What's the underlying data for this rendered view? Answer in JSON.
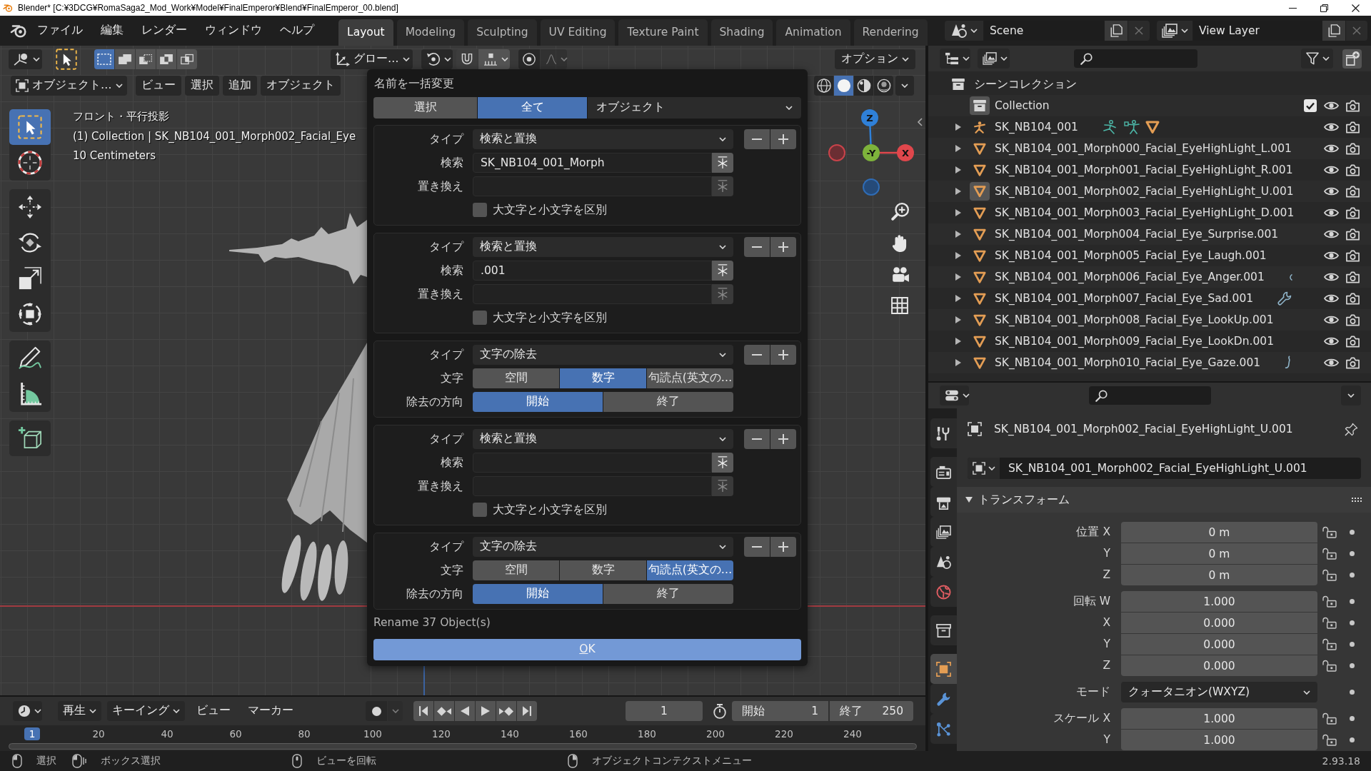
{
  "window": {
    "title": "Blender* [C:¥3DCG¥RomaSaga2_Mod_Work¥Model¥FinalEmperor¥Blend¥FinalEmperor_00.blend]"
  },
  "top_bar": {
    "menus": [
      "ファイル",
      "編集",
      "レンダー",
      "ウィンドウ",
      "ヘルプ"
    ],
    "workspaces": [
      {
        "label": "Layout",
        "selected": true
      },
      {
        "label": "Modeling",
        "selected": false
      },
      {
        "label": "Sculpting",
        "selected": false
      },
      {
        "label": "UV Editing",
        "selected": false
      },
      {
        "label": "Texture Paint",
        "selected": false
      },
      {
        "label": "Shading",
        "selected": false
      },
      {
        "label": "Animation",
        "selected": false
      },
      {
        "label": "Rendering",
        "selected": false
      }
    ],
    "scene": "Scene",
    "view_layer": "View Layer"
  },
  "viewport": {
    "select_modes": [
      {
        "kind": "set",
        "selected": true
      },
      {
        "kind": "extend",
        "selected": false
      },
      {
        "kind": "subtract",
        "selected": false
      },
      {
        "kind": "difference",
        "selected": false
      },
      {
        "kind": "intersect",
        "selected": false
      }
    ],
    "orientation": "グロー…",
    "options": "オプション",
    "mode": "オブジェクト…",
    "menus": [
      "ビュー",
      "選択",
      "追加",
      "オブジェクト"
    ],
    "shading_modes": [
      {
        "kind": "wireframe",
        "selected": false
      },
      {
        "kind": "solid",
        "selected": true
      },
      {
        "kind": "material",
        "selected": false
      },
      {
        "kind": "rendered",
        "selected": false
      }
    ],
    "overlay_text": [
      "フロント・平行投影",
      "(1) Collection | SK_NB104_001_Morph002_Facial_Eye",
      "10 Centimeters"
    ],
    "tool_groups": [
      {
        "tools": [
          {
            "kind": "select_box",
            "selected": true
          },
          {
            "kind": "cursor",
            "selected": false
          }
        ]
      },
      {
        "tools": [
          {
            "kind": "move",
            "selected": false
          },
          {
            "kind": "rotate",
            "selected": false
          },
          {
            "kind": "scale",
            "selected": false
          },
          {
            "kind": "transform",
            "selected": false
          }
        ]
      },
      {
        "tools": [
          {
            "kind": "annotate",
            "selected": false
          },
          {
            "kind": "measure",
            "selected": false
          }
        ]
      },
      {
        "tools": [
          {
            "kind": "add_cube",
            "selected": false
          }
        ]
      }
    ],
    "gizmo_axes": [
      {
        "kind": "z",
        "label": "Z"
      },
      {
        "kind": "y",
        "label": "-Y"
      },
      {
        "kind": "x",
        "label": "X"
      }
    ]
  },
  "rename_dialog": {
    "title": "名前を一括変更",
    "scope": [
      {
        "label": "選択",
        "selected": false
      },
      {
        "label": "全て",
        "selected": true
      }
    ],
    "data_type": "オブジェクト",
    "actions": [
      {
        "kind": "replace",
        "type_label": "タイプ",
        "type": "検索と置換",
        "find_label": "検索",
        "find": "SK_NB104_001_Morph",
        "find_regex_disabled": false,
        "replace_label": "置き換え",
        "replace_regex_disabled": true,
        "case_label": "大文字と小文字を区別",
        "case_sensitive": false
      },
      {
        "kind": "replace",
        "type_label": "タイプ",
        "type": "検索と置換",
        "find_label": "検索",
        "find": ".001",
        "find_regex_disabled": false,
        "replace_label": "置き換え",
        "replace_regex_disabled": true,
        "case_label": "大文字と小文字を区別",
        "case_sensitive": false
      },
      {
        "kind": "strip",
        "type_label": "タイプ",
        "type": "文字の除去",
        "chars_label": "文字",
        "chars": [
          {
            "label": "空間",
            "selected": false
          },
          {
            "label": "数字",
            "selected": true
          },
          {
            "label": "句読点(英文の…",
            "selected": false
          }
        ],
        "direction_label": "除去の方向",
        "directions": [
          {
            "label": "開始",
            "selected": true
          },
          {
            "label": "終了",
            "selected": false
          }
        ]
      },
      {
        "kind": "replace",
        "type_label": "タイプ",
        "type": "検索と置換",
        "find_label": "検索",
        "find_regex_disabled": false,
        "replace_label": "置き換え",
        "replace_regex_disabled": true,
        "case_label": "大文字と小文字を区別",
        "case_sensitive": false
      },
      {
        "kind": "strip",
        "type_label": "タイプ",
        "type": "文字の除去",
        "chars_label": "文字",
        "chars": [
          {
            "label": "空間",
            "selected": false
          },
          {
            "label": "数字",
            "selected": false
          },
          {
            "label": "句読点(英文の…",
            "selected": true
          }
        ],
        "direction_label": "除去の方向",
        "directions": [
          {
            "label": "開始",
            "selected": true
          },
          {
            "label": "終了",
            "selected": false
          }
        ]
      }
    ],
    "info": "Rename 37 Object(s)",
    "ok": "OK"
  },
  "outliner": {
    "scene_collection": "シーンコレクション",
    "collection": {
      "label": "Collection",
      "active": true,
      "checked": true
    },
    "objects": [
      {
        "name": "SK_NB104_001",
        "kind": "armature",
        "active": false,
        "expanded": false,
        "extras": [
          {
            "kind": "pose"
          },
          {
            "kind": "armature_data"
          },
          {
            "kind": "mesh"
          }
        ]
      },
      {
        "name": "SK_NB104_001_Morph000_Facial_EyeHighLight_L.001",
        "kind": "mesh",
        "active": false,
        "expanded": false
      },
      {
        "name": "SK_NB104_001_Morph001_Facial_EyeHighLight_R.001",
        "kind": "mesh",
        "active": false,
        "expanded": false
      },
      {
        "name": "SK_NB104_001_Morph002_Facial_EyeHighLight_U.001",
        "kind": "mesh",
        "active": true,
        "expanded": false
      },
      {
        "name": "SK_NB104_001_Morph003_Facial_EyeHighLight_D.001",
        "kind": "mesh",
        "active": false,
        "expanded": false
      },
      {
        "name": "SK_NB104_001_Morph004_Facial_Eye_Surprise.001",
        "kind": "mesh",
        "active": false,
        "expanded": false
      },
      {
        "name": "SK_NB104_001_Morph005_Facial_Eye_Laugh.001",
        "kind": "mesh",
        "active": false,
        "expanded": false
      },
      {
        "name": "SK_NB104_001_Morph006_Facial_Eye_Anger.001",
        "kind": "mesh",
        "active": false,
        "expanded": false,
        "extras": [
          {
            "kind": "arc"
          }
        ]
      },
      {
        "name": "SK_NB104_001_Morph007_Facial_Eye_Sad.001",
        "kind": "mesh",
        "active": false,
        "expanded": false,
        "extras": [
          {
            "kind": "modifier"
          }
        ]
      },
      {
        "name": "SK_NB104_001_Morph008_Facial_Eye_LookUp.001",
        "kind": "mesh",
        "active": false,
        "expanded": false
      },
      {
        "name": "SK_NB104_001_Morph009_Facial_Eye_LookDn.001",
        "kind": "mesh",
        "active": false,
        "expanded": false
      },
      {
        "name": "SK_NB104_001_Morph010_Facial_Eye_Gaze.001",
        "kind": "mesh",
        "active": false,
        "expanded": false,
        "extras": [
          {
            "kind": "hook"
          }
        ]
      }
    ]
  },
  "properties": {
    "tabs": [
      {
        "kind": "tool",
        "selected": false
      },
      {
        "kind": "render",
        "selected": false
      },
      {
        "kind": "output",
        "selected": false
      },
      {
        "kind": "view_layer",
        "selected": false
      },
      {
        "kind": "scene",
        "selected": false
      },
      {
        "kind": "world",
        "selected": false
      },
      {
        "kind": "collection",
        "selected": false
      },
      {
        "kind": "object",
        "selected": true
      },
      {
        "kind": "modifier",
        "selected": false
      },
      {
        "kind": "particles",
        "selected": false
      }
    ],
    "context": "SK_NB104_001_Morph002_Facial_EyeHighLight_U.001",
    "name": "SK_NB104_001_Morph002_Facial_EyeHighLight_U.001",
    "panel": {
      "title": "トランスフォーム",
      "expanded": true
    },
    "groups": [
      {
        "kind": "number",
        "rows": [
          {
            "label": "位置 X",
            "value": "0 m",
            "locked": false
          },
          {
            "label": "Y",
            "value": "0 m",
            "locked": false
          },
          {
            "label": "Z",
            "value": "0 m",
            "locked": false
          }
        ]
      },
      {
        "kind": "number",
        "rows": [
          {
            "label": "回転 W",
            "value": "1.000",
            "locked": false
          },
          {
            "label": "X",
            "value": "0.000",
            "locked": false
          },
          {
            "label": "Y",
            "value": "0.000",
            "locked": false
          },
          {
            "label": "Z",
            "value": "0.000",
            "locked": false
          }
        ]
      },
      {
        "kind": "dropdown",
        "rows": [
          {
            "label": "モード",
            "value": "クォータニオン(WXYZ)"
          }
        ]
      },
      {
        "kind": "number",
        "rows": [
          {
            "label": "スケール X",
            "value": "1.000",
            "locked": false
          },
          {
            "label": "Y",
            "value": "1.000",
            "locked": false
          }
        ]
      }
    ]
  },
  "timeline": {
    "menus": [
      {
        "label": "再生",
        "kind": "dropdown"
      },
      {
        "label": "キーイング",
        "kind": "dropdown"
      },
      {
        "label": "ビュー",
        "kind": "menu"
      },
      {
        "label": "マーカー",
        "kind": "menu"
      }
    ],
    "current_frame": "1",
    "start_label": "開始",
    "start": "1",
    "end_label": "終了",
    "end": "250",
    "ruler": [
      {
        "label": "1",
        "selected": true
      },
      {
        "label": "20",
        "selected": false
      },
      {
        "label": "40",
        "selected": false
      },
      {
        "label": "60",
        "selected": false
      },
      {
        "label": "80",
        "selected": false
      },
      {
        "label": "100",
        "selected": false
      },
      {
        "label": "120",
        "selected": false
      },
      {
        "label": "140",
        "selected": false
      },
      {
        "label": "160",
        "selected": false
      },
      {
        "label": "180",
        "selected": false
      },
      {
        "label": "200",
        "selected": false
      },
      {
        "label": "220",
        "selected": false
      },
      {
        "label": "240",
        "selected": false
      }
    ]
  },
  "status_bar": {
    "hints": [
      {
        "kind": "left_click",
        "label": "選択"
      },
      {
        "kind": "left_drag",
        "label": "ボックス選択"
      },
      {
        "kind": "middle_drag",
        "label": "ビューを回転"
      },
      {
        "kind": "right_click",
        "label": "オブジェクトコンテクストメニュー"
      }
    ],
    "version": "2.93.18"
  }
}
